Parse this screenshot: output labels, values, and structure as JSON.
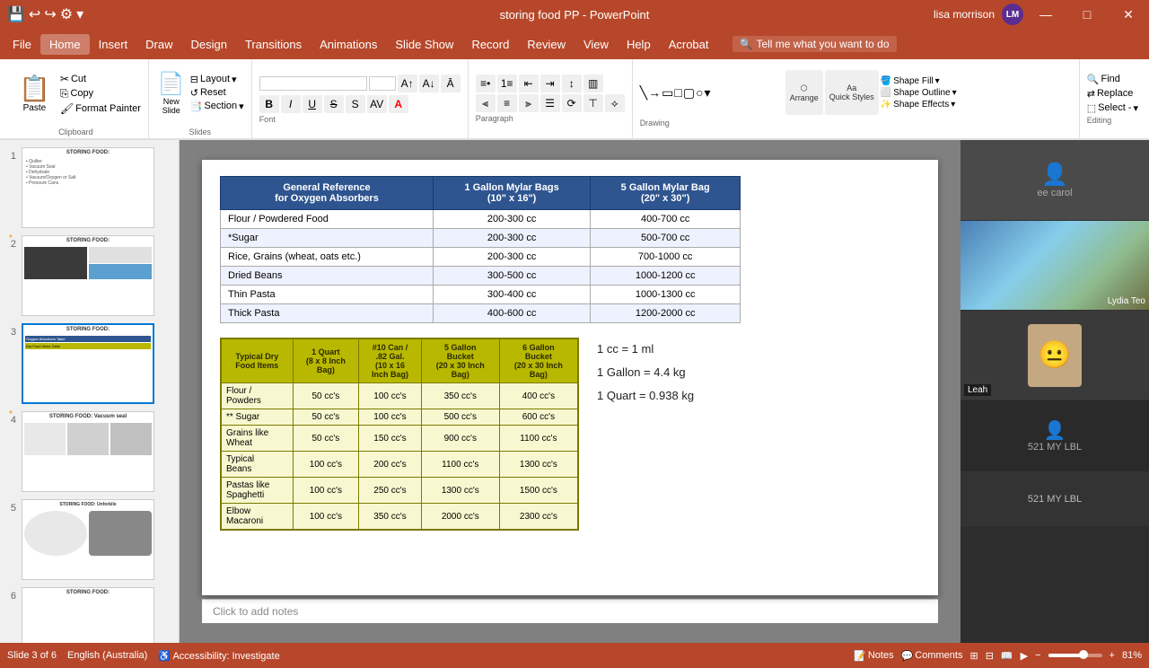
{
  "app": {
    "title": "storing food PP - PowerPoint",
    "user": "lisa morrison",
    "user_initials": "LM"
  },
  "titlebar": {
    "save_icon": "💾",
    "undo_icon": "↩",
    "redo_icon": "↪",
    "close": "✕",
    "minimize": "—",
    "maximize": "□"
  },
  "menu": {
    "items": [
      "File",
      "Home",
      "Insert",
      "Draw",
      "Design",
      "Transitions",
      "Animations",
      "Slide Show",
      "Record",
      "Review",
      "View",
      "Help",
      "Acrobat"
    ]
  },
  "ribbon": {
    "active_tab": "Home",
    "clipboard": {
      "paste_label": "Paste",
      "cut_label": "Cut",
      "copy_label": "Copy",
      "format_painter_label": "Format Painter",
      "group_label": "Clipboard"
    },
    "slides": {
      "new_slide_label": "New\nSlide",
      "layout_label": "Layout",
      "reset_label": "Reset",
      "section_label": "Section",
      "group_label": "Slides"
    },
    "font": {
      "font_name": "",
      "font_size": "",
      "group_label": "Font"
    },
    "paragraph": {
      "group_label": "Paragraph"
    },
    "drawing": {
      "arrange_label": "Arrange",
      "quick_styles_label": "Quick\nStyles",
      "shape_fill_label": "Shape Fill",
      "shape_outline_label": "Shape Outline",
      "shape_effects_label": "Shape Effects",
      "group_label": "Drawing"
    },
    "editing": {
      "find_label": "Find",
      "replace_label": "Replace",
      "select_label": "Select -",
      "group_label": "Editing"
    },
    "search_placeholder": "Tell me what you want to do"
  },
  "slides": [
    {
      "num": "1",
      "title": "STORING FOOD:",
      "content": "• Quilter\n• Vacuum Seal\n• Dehydrate\n• Vacuum/Oxygen or Salt\n• Pressure Cans",
      "active": false,
      "starred": false
    },
    {
      "num": "2",
      "title": "STORING FOOD:",
      "content": "",
      "active": false,
      "starred": true,
      "has_images": true
    },
    {
      "num": "3",
      "title": "STORING FOOD:",
      "content": "",
      "active": true,
      "starred": false
    },
    {
      "num": "4",
      "title": "STORING FOOD: Vacuum seal",
      "content": "",
      "active": false,
      "starred": true
    },
    {
      "num": "5",
      "title": "STORING FOOD: Unforkile",
      "content": "",
      "active": false,
      "starred": false
    },
    {
      "num": "6",
      "title": "STORING FOOD:",
      "content": "",
      "active": false,
      "starred": false
    }
  ],
  "slide3": {
    "ref_table": {
      "headers": [
        "General Reference\nfor Oxygen Absorbers",
        "1 Gallon Mylar Bags\n(10\" x 16\")",
        "5 Gallon Mylar Bag\n(20\" x 30\")"
      ],
      "rows": [
        [
          "Flour / Powdered Food",
          "200-300 cc",
          "400-700 cc"
        ],
        [
          "*Sugar",
          "200-300 cc",
          "500-700 cc"
        ],
        [
          "Rice, Grains (wheat, oats etc.)",
          "200-300 cc",
          "700-1000 cc"
        ],
        [
          "Dried Beans",
          "300-500 cc",
          "1000-1200 cc"
        ],
        [
          "Thin Pasta",
          "300-400 cc",
          "1000-1300 cc"
        ],
        [
          "Thick Pasta",
          "400-600 cc",
          "1200-2000 cc"
        ]
      ]
    },
    "dry_table": {
      "headers": [
        "Typical Dry\nFood Items",
        "1 Quart\n(8 x 8 Inch\nBag)",
        "#10 Can /\n.82 Gal.\n(10 x 16\nInch Bag)",
        "5 Gallon\nBucket\n(20 x 30 Inch\nBag)",
        "6 Gallon\nBucket\n(20 x 30 Inch\nBag)"
      ],
      "rows": [
        [
          "Flour /\nPowders",
          "50 cc's",
          "100 cc's",
          "350 cc's",
          "400 cc's"
        ],
        [
          "** Sugar",
          "50 cc's",
          "100 cc's",
          "500 cc's",
          "600 cc's"
        ],
        [
          "Grains like\nWheat",
          "50 cc's",
          "150 cc's",
          "900 cc's",
          "1100 cc's"
        ],
        [
          "Typical\nBeans",
          "100 cc's",
          "200 cc's",
          "1100 cc's",
          "1300 cc's"
        ],
        [
          "Pastas like\nSpaghetti",
          "100 cc's",
          "250 cc's",
          "1300 cc's",
          "1500 cc's"
        ],
        [
          "Elbow\nMacaroni",
          "100 cc's",
          "350 cc's",
          "2000 cc's",
          "2300 cc's"
        ]
      ]
    },
    "notes": [
      "1 cc = 1 ml",
      "1 Gallon = 4.4 kg",
      "1 Quart = 0.938 kg"
    ]
  },
  "statusbar": {
    "slide_info": "Slide 3 of 6",
    "language": "English (Australia)",
    "accessibility": "Accessibility: Investigate",
    "notes_label": "Notes",
    "comments_label": "Comments",
    "zoom": "81%"
  },
  "right_panel": {
    "users": [
      {
        "name": "ee carol",
        "label": "ee carol"
      },
      {
        "name": "Leah",
        "label": "Leah"
      },
      {
        "name": "Lydia Teo",
        "label": "Lydia Teo"
      },
      {
        "name": "521 MY LBL",
        "label": "521 MY LBL"
      }
    ]
  },
  "notes_placeholder": "Click to add notes"
}
